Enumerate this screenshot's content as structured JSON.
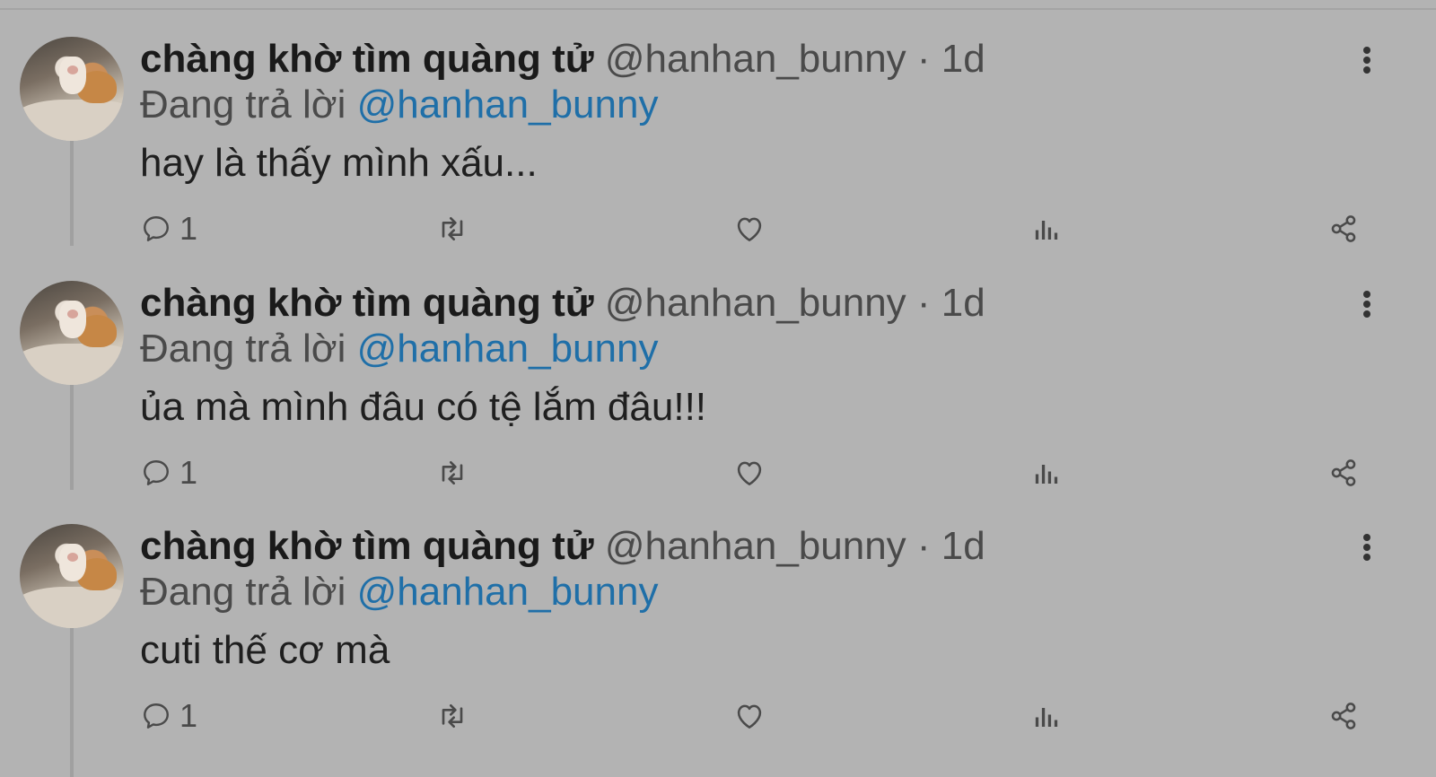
{
  "tweets": [
    {
      "name": "chàng khờ tìm quàng tử",
      "handle": "@hanhan_bunny",
      "separator": "·",
      "time": "1d",
      "replying_prefix": "Đang trả lời",
      "replying_to": "@hanhan_bunny",
      "text": "hay là thấy mình xấu...",
      "reply_count": "1"
    },
    {
      "name": "chàng khờ tìm quàng tử",
      "handle": "@hanhan_bunny",
      "separator": "·",
      "time": "1d",
      "replying_prefix": "Đang trả lời",
      "replying_to": "@hanhan_bunny",
      "text": "ủa mà mình đâu có tệ lắm đâu!!!",
      "reply_count": "1"
    },
    {
      "name": "chàng khờ tìm quàng tử",
      "handle": "@hanhan_bunny",
      "separator": "·",
      "time": "1d",
      "replying_prefix": "Đang trả lời",
      "replying_to": "@hanhan_bunny",
      "text": "cuti thế cơ mà",
      "reply_count": "1"
    }
  ],
  "icons": [
    "reply-icon",
    "retweet-icon",
    "like-icon",
    "views-icon",
    "share-icon",
    "more-icon"
  ],
  "colors": {
    "background": "#b3b3b3",
    "mention": "#1f6fa8",
    "text": "#1f1f1f",
    "secondary": "#4a4a4a"
  }
}
